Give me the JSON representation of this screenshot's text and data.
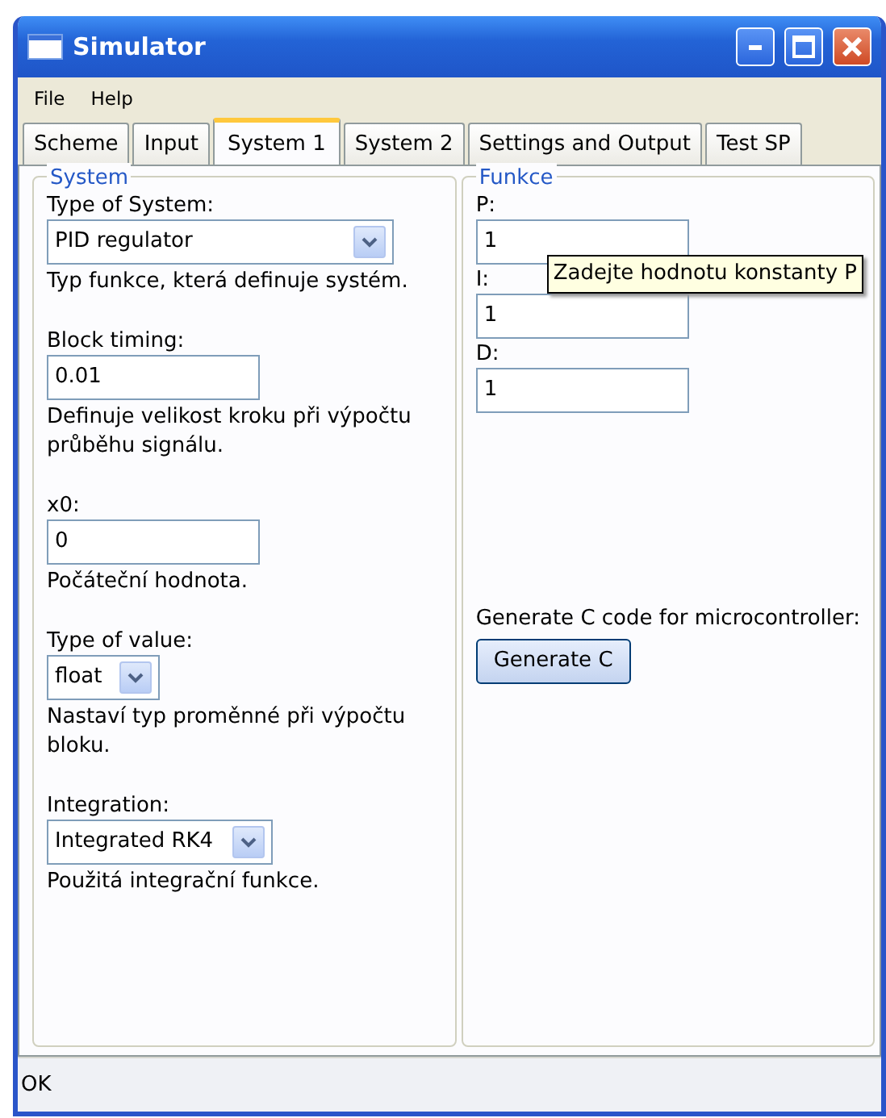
{
  "window": {
    "title": "Simulator"
  },
  "menu": [
    "File",
    "Help"
  ],
  "tabs": [
    {
      "label": "Scheme",
      "selected": false
    },
    {
      "label": "Input",
      "selected": false
    },
    {
      "label": "System 1",
      "selected": true
    },
    {
      "label": "System 2",
      "selected": false
    },
    {
      "label": "Settings and Output",
      "selected": false
    },
    {
      "label": "Test SP",
      "selected": false
    }
  ],
  "system_group": {
    "title": "System",
    "fields": [
      {
        "label": "Type of System:",
        "kind": "combo",
        "value": "PID regulator",
        "description": "Typ funkce, která definuje systém."
      },
      {
        "label": "Block timing:",
        "kind": "text",
        "value": "0.01",
        "description": "Definuje velikost kroku při výpočtu průběhu signálu."
      },
      {
        "label": "x0:",
        "kind": "text",
        "value": "0",
        "description": "Počáteční hodnota."
      },
      {
        "label": "Type of value:",
        "kind": "combo_small",
        "value": "float",
        "description": "Nastaví typ proměnné při výpočtu bloku."
      },
      {
        "label": "Integration:",
        "kind": "combo_mid",
        "value": "Integrated RK4",
        "description": "Použitá integrační funkce."
      }
    ]
  },
  "function_group": {
    "title": "Funkce",
    "fields": [
      {
        "label": "P:",
        "value": "1"
      },
      {
        "label": "I:",
        "value": "1"
      },
      {
        "label": "D:",
        "value": "1"
      }
    ],
    "tooltip": "Zadejte hodnotu konstanty P",
    "generate_label": "Generate C code for microcontroller:",
    "generate_button": "Generate C"
  },
  "status_bar": "OK"
}
